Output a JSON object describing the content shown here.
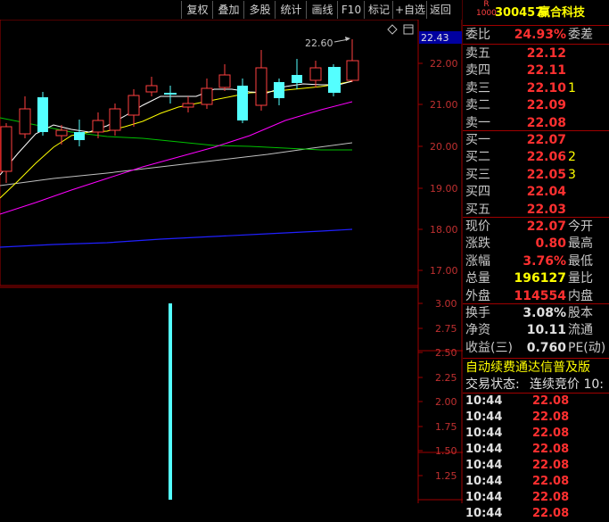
{
  "toolbar": {
    "buttons": [
      "复权",
      "叠加",
      "多股",
      "统计",
      "画线",
      "F10",
      "标记",
      "+自选",
      "返回"
    ]
  },
  "stock": {
    "badge_top": "R",
    "badge_bottom": "1000",
    "code": "300457",
    "name": "赢合科技"
  },
  "chart": {
    "price_labels": [
      "22.00",
      "21.00",
      "20.00",
      "19.00",
      "18.00",
      "17.00"
    ],
    "current_price_tag": "22.43",
    "high_annotation": "22.60",
    "volume_labels": [
      "3.00",
      "2.75",
      "2.50",
      "2.25",
      "2.00",
      "1.75",
      "1.50",
      "1.25"
    ],
    "colors": {
      "up": "#ff4040",
      "down": "#54ffff",
      "ma5": "#ffffff",
      "ma10": "#ffff00",
      "ma20": "#ff00ff",
      "ma60": "#00c000",
      "ma120": "#c0c0c0",
      "ma250": "#2020ff"
    }
  },
  "order_book": {
    "webi_label": "委比",
    "webi_value": "24.93%",
    "weicha_label": "委差",
    "asks": [
      {
        "label": "卖五",
        "price": "22.12"
      },
      {
        "label": "卖四",
        "price": "22.11"
      },
      {
        "label": "卖三",
        "price": "22.10",
        "vol": "1"
      },
      {
        "label": "卖二",
        "price": "22.09"
      },
      {
        "label": "卖一",
        "price": "22.08"
      }
    ],
    "bids": [
      {
        "label": "买一",
        "price": "22.07"
      },
      {
        "label": "买二",
        "price": "22.06",
        "vol": "2"
      },
      {
        "label": "买三",
        "price": "22.05",
        "vol": "3"
      },
      {
        "label": "买四",
        "price": "22.04"
      },
      {
        "label": "买五",
        "price": "22.03"
      }
    ]
  },
  "quote": {
    "rows": [
      {
        "l1": "现价",
        "v": "22.07",
        "l2": "今开",
        "c": "red"
      },
      {
        "l1": "涨跌",
        "v": "0.80",
        "l2": "最高",
        "c": "red"
      },
      {
        "l1": "涨幅",
        "v": "3.76%",
        "l2": "最低",
        "c": "red"
      },
      {
        "l1": "总量",
        "v": "196127",
        "l2": "量比",
        "c": "yellow"
      },
      {
        "l1": "外盘",
        "v": "114554",
        "l2": "内盘",
        "c": "red"
      }
    ],
    "rows2": [
      {
        "l1": "换手",
        "v": "3.08%",
        "l2": "股本"
      },
      {
        "l1": "净资",
        "v": "10.11",
        "l2": "流通"
      },
      {
        "l1": "收益(三)",
        "v": "0.760",
        "l2": "PE(动)"
      }
    ],
    "banner": "自动续费通达信普及版",
    "trade_status_label": "交易状态:",
    "trade_status_value": "连续竞价 10:"
  },
  "ticks": [
    {
      "time": "10:44",
      "price": "22.08"
    },
    {
      "time": "10:44",
      "price": "22.08"
    },
    {
      "time": "10:44",
      "price": "22.08"
    },
    {
      "time": "10:44",
      "price": "22.08"
    },
    {
      "time": "10:44",
      "price": "22.08"
    },
    {
      "time": "10:44",
      "price": "22.08"
    },
    {
      "time": "10:44",
      "price": "22.08"
    },
    {
      "time": "10:44",
      "price": "22.08"
    }
  ]
}
